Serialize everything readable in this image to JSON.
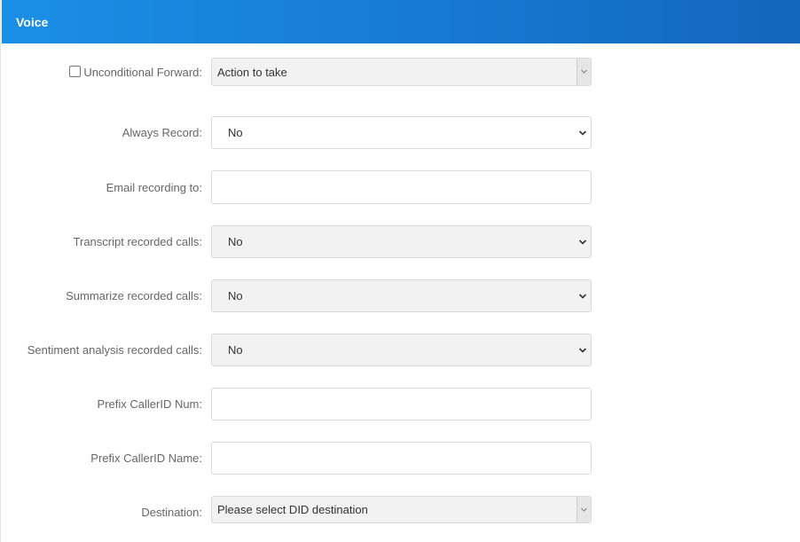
{
  "panel": {
    "title": "Voice"
  },
  "fields": {
    "unconditional_forward": {
      "label": "Unconditional Forward:",
      "value": "Action to take",
      "checked": false
    },
    "always_record": {
      "label": "Always Record:",
      "value": "No"
    },
    "email_recording": {
      "label": "Email recording to:",
      "value": ""
    },
    "transcript": {
      "label": "Transcript recorded calls:",
      "value": "No"
    },
    "summarize": {
      "label": "Summarize recorded calls:",
      "value": "No"
    },
    "sentiment": {
      "label": "Sentiment analysis recorded calls:",
      "value": "No"
    },
    "prefix_num": {
      "label": "Prefix CallerID Num:",
      "value": ""
    },
    "prefix_name": {
      "label": "Prefix CallerID Name:",
      "value": ""
    },
    "destination": {
      "label": "Destination:",
      "value": "Please select DID destination"
    }
  },
  "icons": {
    "select": "chevron-down-icon",
    "combo": "chevron-down-icon"
  }
}
